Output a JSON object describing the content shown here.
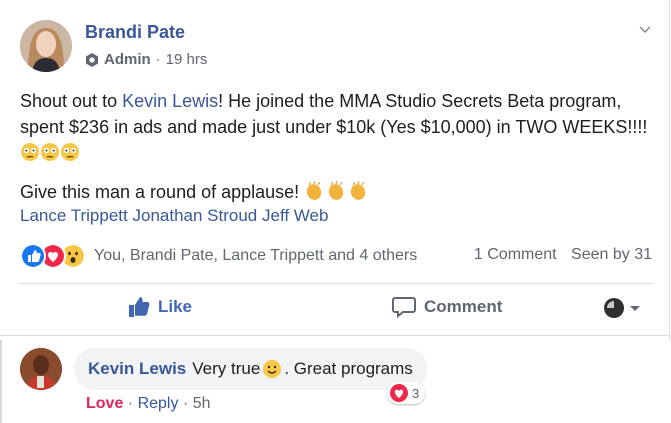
{
  "post": {
    "author": "Brandi Pate",
    "role": "Admin",
    "separator": "·",
    "time": "19 hrs",
    "line1_pre": "Shout out to ",
    "mention": "Kevin Lewis",
    "line1_post": "! He joined the MMA Studio Secrets Beta program, spent $236 in ads and made just under $10k (Yes $10,000) in TWO WEEKS!!!! ",
    "line2": "Give this man a round of applause! ",
    "tags": [
      "Lance Trippett",
      "Jonathan Stroud",
      "Jeff Web"
    ]
  },
  "reactions": {
    "summary": "You, Brandi Pate, Lance Trippett and 4 others",
    "comments": "1 Comment",
    "seen": "Seen by 31",
    "icons": [
      "like-icon",
      "love-icon",
      "wow-icon"
    ]
  },
  "actions": {
    "like": "Like",
    "comment": "Comment"
  },
  "comment": {
    "author": "Kevin Lewis",
    "text_pre": "Very true ",
    "text_post": ". Great programs",
    "reaction_count": "3",
    "love": "Love",
    "sep": "·",
    "reply": "Reply",
    "time": "5h"
  },
  "colors": {
    "link": "#385898",
    "love": "#e0245e",
    "like": "#1877f2"
  }
}
